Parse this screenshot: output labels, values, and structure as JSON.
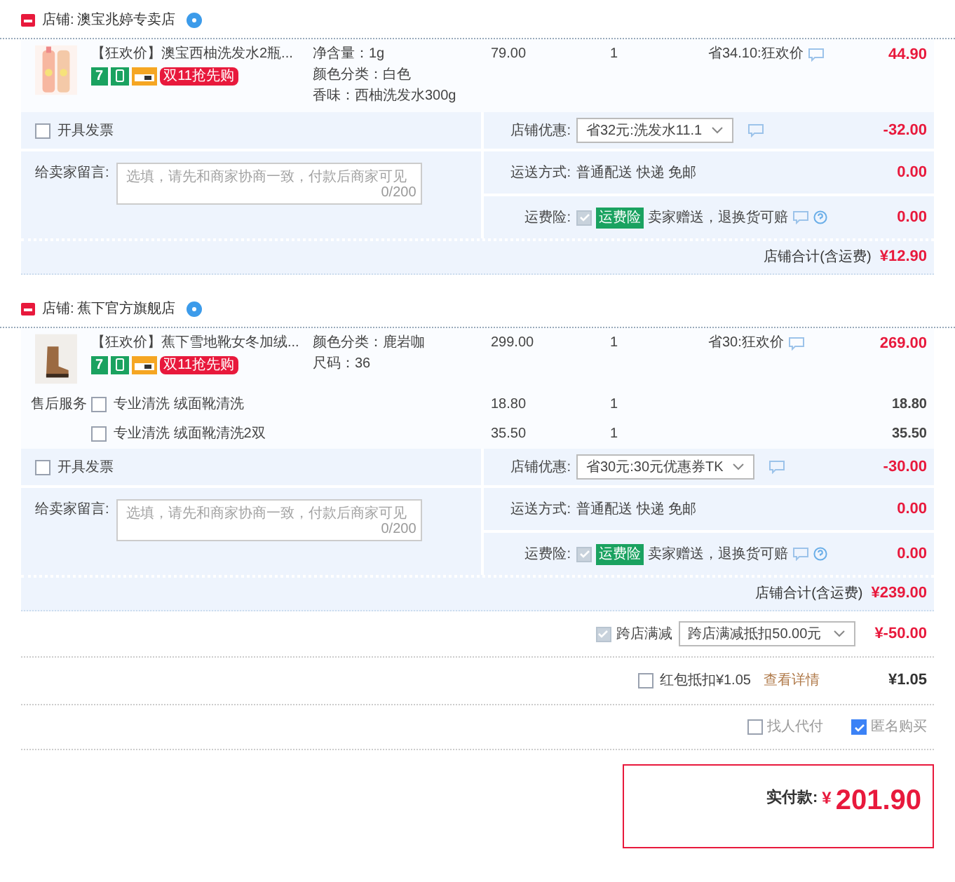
{
  "shops": [
    {
      "label": "店铺:",
      "name": "澳宝兆婷专卖店",
      "items": [
        {
          "title": "【狂欢价】澳宝西柚洗发水2瓶...",
          "badges": [
            {
              "kind": "number",
              "text": "7"
            },
            {
              "kind": "phone"
            },
            {
              "kind": "card"
            },
            {
              "kind": "promo",
              "text": "双11抢先购"
            }
          ],
          "specs": [
            "净含量：1g",
            "颜色分类：白色",
            "香味：西柚洗发水300g"
          ],
          "price": "79.00",
          "qty": "1",
          "promo": "省34.10:狂欢价",
          "total": "44.90"
        }
      ],
      "invoice": {
        "label": "开具发票",
        "checked": false
      },
      "coupon": {
        "label": "店铺优惠:",
        "value": "省32元:洗发水11.1",
        "amount": "-32.00"
      },
      "message": {
        "label": "给卖家留言:",
        "placeholder": "选填，请先和商家协商一致，付款后商家可见",
        "counter": "0/200"
      },
      "shipping": {
        "label": "运送方式:",
        "value": "普通配送 快递 免邮",
        "amount": "0.00"
      },
      "insurance": {
        "label": "运费险:",
        "checked": true,
        "tag": "运费险",
        "text": "卖家赠送，退换货可赔",
        "amount": "0.00"
      },
      "subtotal": {
        "label": "店铺合计(含运费)",
        "value": "¥12.90"
      }
    },
    {
      "label": "店铺:",
      "name": "蕉下官方旗舰店",
      "items": [
        {
          "title": "【狂欢价】蕉下雪地靴女冬加绒...",
          "badges": [
            {
              "kind": "number",
              "text": "7"
            },
            {
              "kind": "phone"
            },
            {
              "kind": "card"
            },
            {
              "kind": "promo",
              "text": "双11抢先购"
            }
          ],
          "specs": [
            "颜色分类：鹿岩咖",
            "尺码：36"
          ],
          "price": "299.00",
          "qty": "1",
          "promo": "省30:狂欢价",
          "total": "269.00"
        }
      ],
      "services_label": "售后服务",
      "services": [
        {
          "name": "专业清洗 绒面靴清洗",
          "checked": false,
          "price": "18.80",
          "qty": "1",
          "total": "18.80"
        },
        {
          "name": "专业清洗 绒面靴清洗2双",
          "checked": false,
          "price": "35.50",
          "qty": "1",
          "total": "35.50"
        }
      ],
      "invoice": {
        "label": "开具发票",
        "checked": false
      },
      "coupon": {
        "label": "店铺优惠:",
        "value": "省30元:30元优惠券TK",
        "amount": "-30.00"
      },
      "message": {
        "label": "给卖家留言:",
        "placeholder": "选填，请先和商家协商一致，付款后商家可见",
        "counter": "0/200"
      },
      "shipping": {
        "label": "运送方式:",
        "value": "普通配送 快递 免邮",
        "amount": "0.00"
      },
      "insurance": {
        "label": "运费险:",
        "checked": true,
        "tag": "运费险",
        "text": "卖家赠送，退换货可赔",
        "amount": "0.00"
      },
      "subtotal": {
        "label": "店铺合计(含运费)",
        "value": "¥239.00"
      }
    }
  ],
  "cross_store": {
    "checked": true,
    "label": "跨店满减",
    "value": "跨店满减抵扣50.00元",
    "amount": "¥-50.00"
  },
  "red_packet": {
    "checked": false,
    "label": "红包抵扣¥1.05",
    "link": "查看详情",
    "amount": "¥1.05"
  },
  "options": [
    {
      "label": "找人代付",
      "checked": false
    },
    {
      "label": "匿名购买",
      "checked": true
    }
  ],
  "payment": {
    "label": "实付款:",
    "currency": "¥",
    "value": "201.90"
  }
}
